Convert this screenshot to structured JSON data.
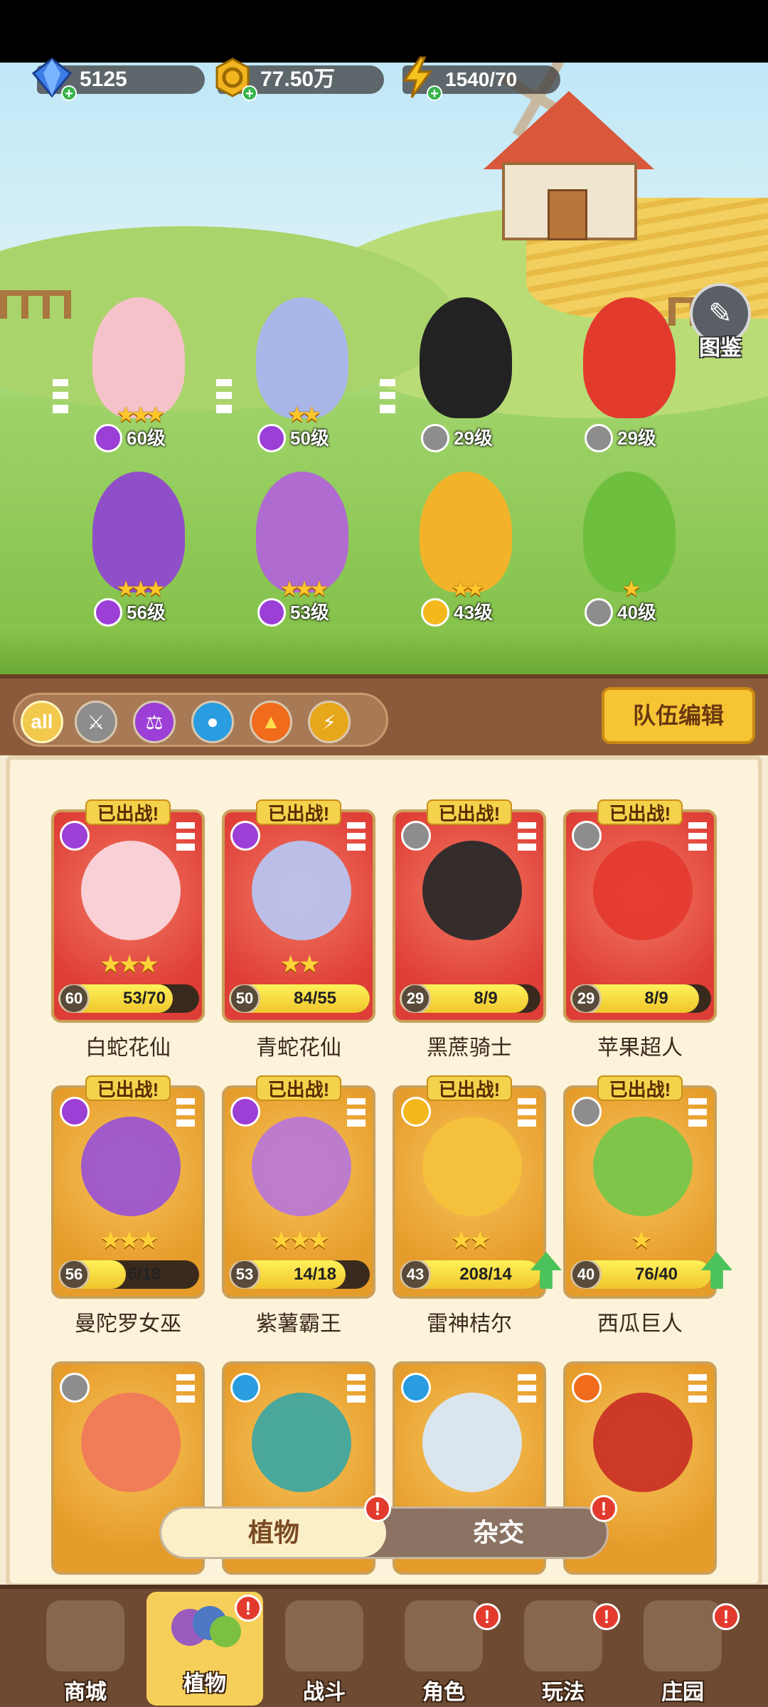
{
  "currencies": [
    {
      "name": "gem",
      "value": "5125",
      "icon": "gem-icon",
      "color": "#3d7ee6"
    },
    {
      "name": "gold",
      "value": "77.50万",
      "icon": "coin-icon",
      "color": "#f3b51f"
    },
    {
      "name": "energy",
      "value": "1540/70",
      "icon": "lightning-icon",
      "color": "#f6c21c"
    }
  ],
  "guide_label": "图鉴",
  "lineup": [
    {
      "element": "poison",
      "stars": 3,
      "level": "60级"
    },
    {
      "element": "poison",
      "stars": 2,
      "level": "50级"
    },
    {
      "element": "sword",
      "stars": 0,
      "level": "29级"
    },
    {
      "element": "sword",
      "stars": 0,
      "level": "29级"
    },
    {
      "element": "poison",
      "stars": 3,
      "level": "56级"
    },
    {
      "element": "poison",
      "stars": 3,
      "level": "53级"
    },
    {
      "element": "lightning",
      "stars": 2,
      "level": "43级"
    },
    {
      "element": "sword",
      "stars": 1,
      "level": "40级"
    }
  ],
  "filters": [
    "all",
    "sword",
    "poison",
    "water",
    "fire",
    "lightning"
  ],
  "team_edit_label": "队伍编辑",
  "deployed_label": "已出战!",
  "cards": [
    {
      "name": "白蛇花仙",
      "level": "60",
      "progress": "53/70",
      "fill": 0.76,
      "stars": 3,
      "rarity": "red",
      "element": "poison",
      "deployed": true,
      "up": false
    },
    {
      "name": "青蛇花仙",
      "level": "50",
      "progress": "84/55",
      "fill": 1.0,
      "stars": 2,
      "rarity": "red",
      "element": "poison",
      "deployed": true,
      "up": false
    },
    {
      "name": "黑蔗骑士",
      "level": "29",
      "progress": "8/9",
      "fill": 0.89,
      "stars": 0,
      "rarity": "red",
      "element": "sword",
      "deployed": true,
      "up": false
    },
    {
      "name": "苹果超人",
      "level": "29",
      "progress": "8/9",
      "fill": 0.89,
      "stars": 0,
      "rarity": "red",
      "element": "sword",
      "deployed": true,
      "up": false
    },
    {
      "name": "曼陀罗女巫",
      "level": "56",
      "progress": "6/18",
      "fill": 0.33,
      "stars": 3,
      "rarity": "gold",
      "element": "poison",
      "deployed": true,
      "up": false
    },
    {
      "name": "紫薯霸王",
      "level": "53",
      "progress": "14/18",
      "fill": 0.78,
      "stars": 3,
      "rarity": "gold",
      "element": "poison",
      "deployed": true,
      "up": false
    },
    {
      "name": "雷神桔尔",
      "level": "43",
      "progress": "208/14",
      "fill": 1.0,
      "stars": 2,
      "rarity": "gold",
      "element": "lightning",
      "deployed": true,
      "up": true
    },
    {
      "name": "西瓜巨人",
      "level": "40",
      "progress": "76/40",
      "fill": 1.0,
      "stars": 1,
      "rarity": "gold",
      "element": "sword",
      "deployed": true,
      "up": true
    },
    {
      "name": "",
      "level": "",
      "progress": "",
      "fill": 0,
      "stars": 0,
      "rarity": "gold",
      "element": "sword",
      "deployed": false,
      "up": false
    },
    {
      "name": "",
      "level": "",
      "progress": "",
      "fill": 0,
      "stars": 0,
      "rarity": "gold",
      "element": "water",
      "deployed": false,
      "up": false
    },
    {
      "name": "",
      "level": "",
      "progress": "",
      "fill": 0,
      "stars": 0,
      "rarity": "gold",
      "element": "water",
      "deployed": false,
      "up": false
    },
    {
      "name": "",
      "level": "",
      "progress": "",
      "fill": 0,
      "stars": 0,
      "rarity": "gold",
      "element": "fire",
      "deployed": false,
      "up": false
    }
  ],
  "segment": {
    "plants": "植物",
    "hybrid": "杂交",
    "alert": "!"
  },
  "nav": [
    {
      "label": "商城",
      "alert": false
    },
    {
      "label": "植物",
      "alert": true
    },
    {
      "label": "战斗",
      "alert": false
    },
    {
      "label": "角色",
      "alert": true
    },
    {
      "label": "玩法",
      "alert": true
    },
    {
      "label": "庄园",
      "alert": true
    }
  ],
  "colors": {
    "poison": "#9b3fd6",
    "sword": "#8d8d8d",
    "water": "#2a9de0",
    "fire": "#f06b1c",
    "lightning": "#f4b81d"
  }
}
